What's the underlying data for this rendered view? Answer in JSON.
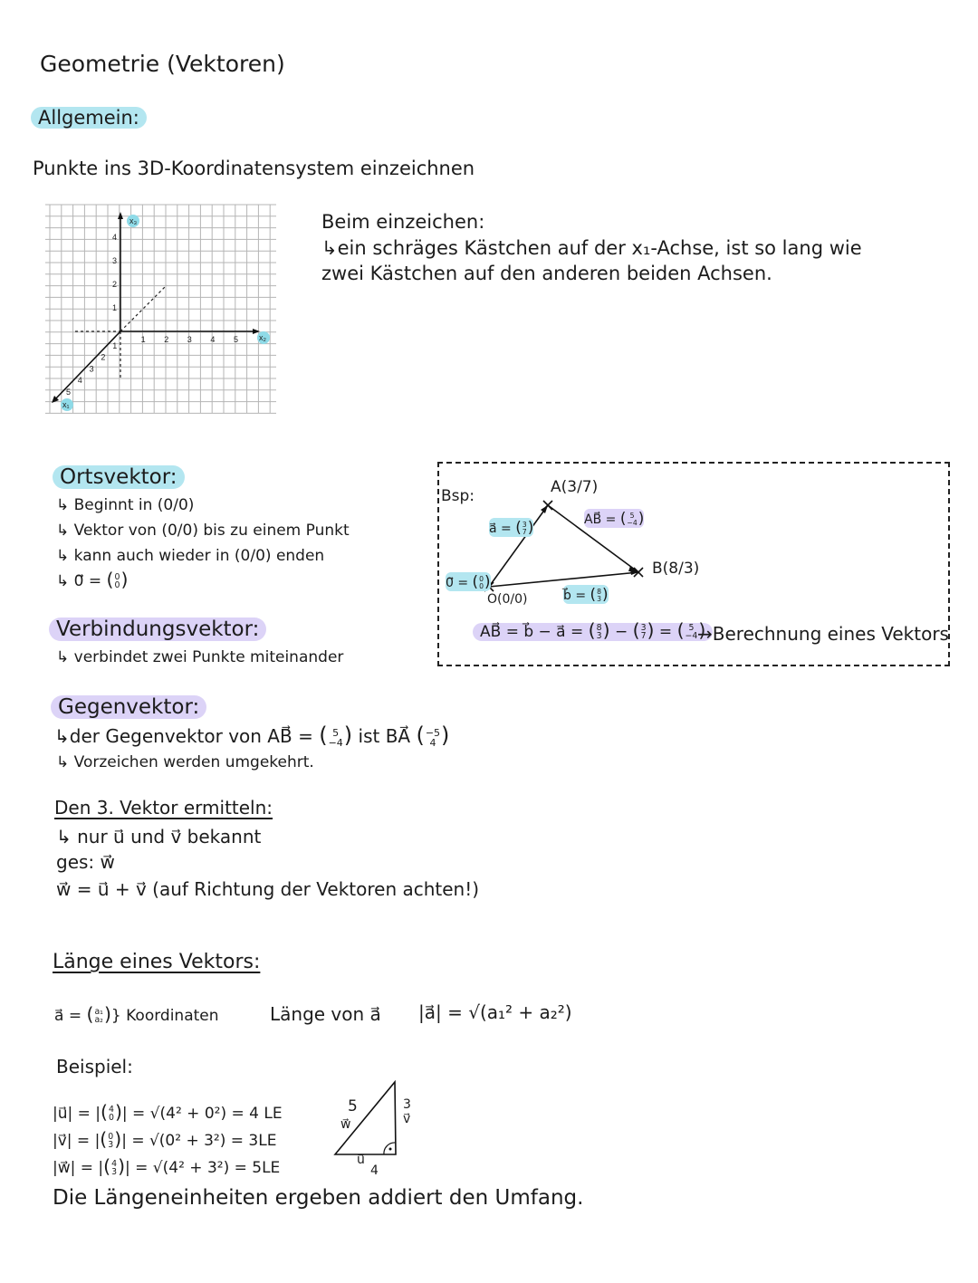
{
  "title": "Geometrie (Vektoren)",
  "allgemein": "Allgemein:",
  "intro": "Punkte ins 3D-Koordinatensystem  einzeichnen",
  "coordinate_system": {
    "x1_label": "x₁",
    "x2_label": "x₂",
    "x3_label": "x₃",
    "x1_ticks": [
      "1",
      "2",
      "3",
      "4",
      "5"
    ],
    "x2_ticks": [
      "1",
      "2",
      "3",
      "4",
      "5"
    ],
    "x3_ticks": [
      "1",
      "2",
      "3",
      "4"
    ],
    "highlight_color": "#8fdbe8"
  },
  "drawing_note": {
    "heading": "Beim einzeichen:",
    "line1": "↳ein schräges Kästchen auf der x₁-Achse, ist so lang wie",
    "line2": "zwei Kästchen auf den anderen beiden Achsen."
  },
  "ortsvektor": {
    "heading": "Ortsvektor:",
    "items": [
      "↳ Beginnt  in  (0/0)",
      "↳ Vektor  von  (0/0)  bis zu einem  Punkt",
      "↳ kann  auch  wieder  in  (0/0) enden",
      "↳ 0⃗ = [0|0]"
    ]
  },
  "verbindungsvektor": {
    "heading": "Verbindungsvektor:",
    "items": [
      "↳ verbindet  zwei  Punkte  miteinander"
    ]
  },
  "example": {
    "label": "Bsp:",
    "point_a": "A(3/7)",
    "point_b": "B(8/3)",
    "point_o": "O(0/0)",
    "vec_a": "a⃗ = [3|7]",
    "vec_ab": "AB⃗ = [5|−4]",
    "vec_o": "0⃗ = [0|0]",
    "vec_b": "b⃗ = [8|3]",
    "formula": "AB⃗ = b⃗ − a⃗  = [8|3] − [3|7] = [5|−4]",
    "formula_note": "→Berechnung eines Vektors"
  },
  "gegenvektor": {
    "heading": "Gegenvektor:",
    "items": [
      "↳der  Gegenvektor  von  AB⃗ = [5|−4]  ist  BA⃗ [−5|4]",
      "↳ Vorzeichen  werden  umgekehrt."
    ]
  },
  "dritter_vektor": {
    "heading": "Den 3. Vektor ermitteln:",
    "items": [
      "↳ nur  u⃗  und  v⃗  bekannt",
      "ges: w⃗",
      "w⃗ = u⃗ + v⃗  (auf Richtung der Vektoren achten!)"
    ]
  },
  "laenge": {
    "heading": "Länge eines Vektors:",
    "def": "a⃗ = [a₁|a₂]} Koordinaten",
    "def_label": "Länge  von  a⃗",
    "def_formula": "|a⃗| = √(a₁² + a₂²)",
    "example_heading": "Beispiel:",
    "examples": [
      "|u⃗| = |[4|0]| = √(4² + 0²)  = 4 LE",
      "|v⃗| = |[0|3]| = √(0² + 3²) = 3LE",
      "|w⃗| = |[4|3]| = √(4² + 3²) = 5LE"
    ],
    "triangle": {
      "hyp": "5",
      "hyp_vec": "w⃗",
      "right": "3",
      "right_vec": "v⃗",
      "bottom": "4",
      "bottom_vec": "u⃗"
    },
    "conclusion": "Die Längeneinheiten ergeben addiert den Umfang."
  },
  "colors": {
    "cyan_highlight": "#b3e6f0",
    "lavender_highlight": "#dcd3f7"
  }
}
